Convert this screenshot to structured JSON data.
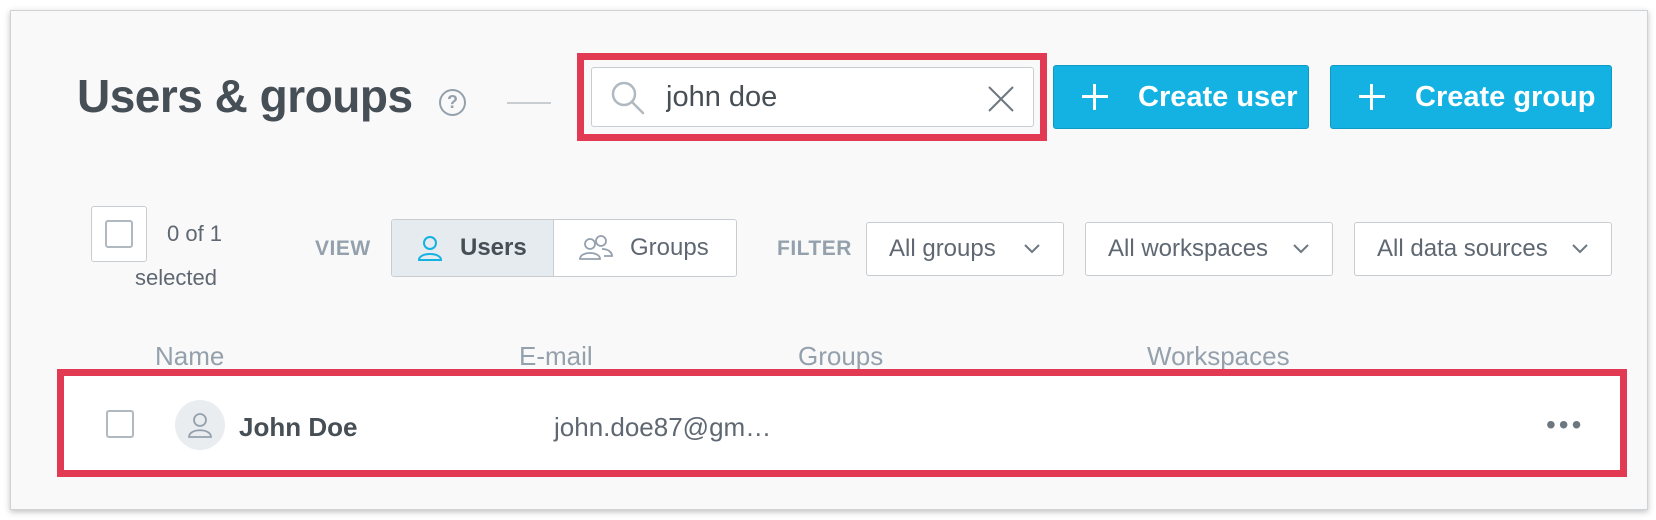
{
  "header": {
    "title": "Users & groups",
    "help_glyph": "?"
  },
  "search": {
    "value": "john doe",
    "placeholder": "",
    "icon": "search-icon",
    "clear_icon": "close-icon"
  },
  "actions": {
    "create_user_label": "Create user",
    "create_group_label": "Create group",
    "accent_color": "#14b2e2"
  },
  "selection": {
    "count_text": "0 of 1",
    "selected_word": "selected"
  },
  "view": {
    "label": "VIEW",
    "options": [
      {
        "label": "Users",
        "icon": "user-icon",
        "active": true
      },
      {
        "label": "Groups",
        "icon": "users-icon",
        "active": false
      }
    ]
  },
  "filter": {
    "label": "FILTER",
    "dropdowns": [
      {
        "value": "All groups"
      },
      {
        "value": "All workspaces"
      },
      {
        "value": "All data sources"
      }
    ]
  },
  "table": {
    "columns": [
      "Name",
      "E-mail",
      "Groups",
      "Workspaces"
    ],
    "rows": [
      {
        "name": "John Doe",
        "email": "john.doe87@gm…",
        "groups": "",
        "workspaces": "",
        "more": "•••"
      }
    ]
  },
  "highlight_color": "#e23a52"
}
